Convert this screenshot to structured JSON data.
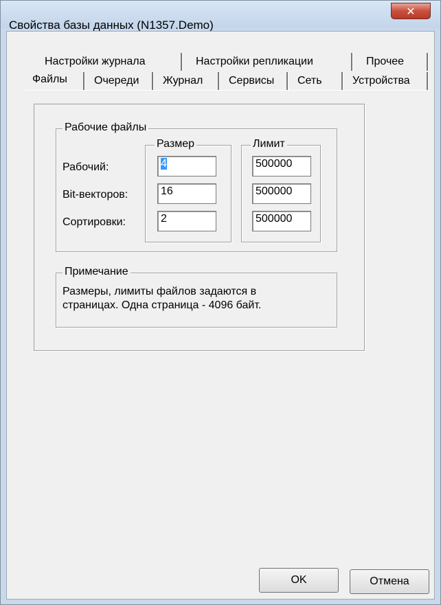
{
  "window": {
    "title": "Свойства базы данных (N1357.Demo)",
    "close_glyph": "✕"
  },
  "tabs_back": [
    {
      "label": "Настройки журнала"
    },
    {
      "label": "Настройки репликации"
    },
    {
      "label": "Прочее"
    }
  ],
  "tabs_front": [
    {
      "label": "Файлы",
      "selected": true
    },
    {
      "label": "Очереди"
    },
    {
      "label": "Журнал"
    },
    {
      "label": "Сервисы"
    },
    {
      "label": "Сеть"
    },
    {
      "label": "Устройства"
    }
  ],
  "work_files": {
    "legend": "Рабочие файлы",
    "size_header": "Размер",
    "limit_header": "Лимит",
    "rows": [
      {
        "label": "Рабочий:",
        "size": "4",
        "limit": "500000"
      },
      {
        "label": "Bit-векторов:",
        "size": "16",
        "limit": "500000"
      },
      {
        "label": "Сортировки:",
        "size": "2",
        "limit": "500000"
      }
    ]
  },
  "note": {
    "legend": "Примечание",
    "line1": "Размеры, лимиты файлов задаются в",
    "line2": "страницах. Одна страница - 4096 байт."
  },
  "buttons": {
    "ok": "OK",
    "cancel": "Отмена"
  }
}
